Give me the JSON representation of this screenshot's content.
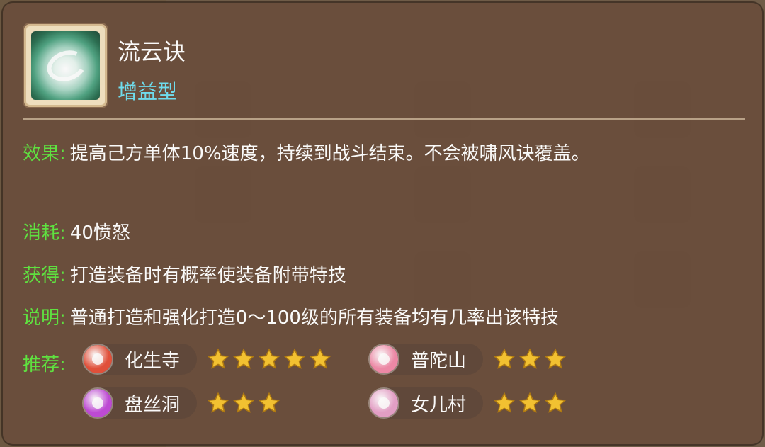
{
  "skill": {
    "name": "流云诀",
    "type": "增益型",
    "icon": "swirl-cloud-icon"
  },
  "details": {
    "effect_label": "效果",
    "effect_text": "提高己方单体10%速度，持续到战斗结束。不会被啸风诀覆盖。",
    "cost_label": "消耗",
    "cost_text": "40愤怒",
    "obtain_label": "获得",
    "obtain_text": "打造装备时有概率使装备附带特技",
    "note_label": "说明",
    "note_text": "普通打造和强化打造0～100级的所有装备均有几率出该特技"
  },
  "recommend": {
    "label": "推荐",
    "items": [
      {
        "name": "化生寺",
        "stars": 5,
        "badge_color": "#e4503a",
        "icon": "huashengsi-emblem-icon"
      },
      {
        "name": "普陀山",
        "stars": 3,
        "badge_color": "#f08aa8",
        "icon": "putuoshan-lotus-icon"
      },
      {
        "name": "盘丝洞",
        "stars": 3,
        "badge_color": "#c04ad8",
        "icon": "pansidong-web-icon"
      },
      {
        "name": "女儿村",
        "stars": 3,
        "badge_color": "#e6a0c8",
        "icon": "nvercun-flower-icon"
      }
    ]
  },
  "colors": {
    "label_green": "#5fe640",
    "type_cyan": "#6fe0f2",
    "star_gold": "#f7c531"
  }
}
